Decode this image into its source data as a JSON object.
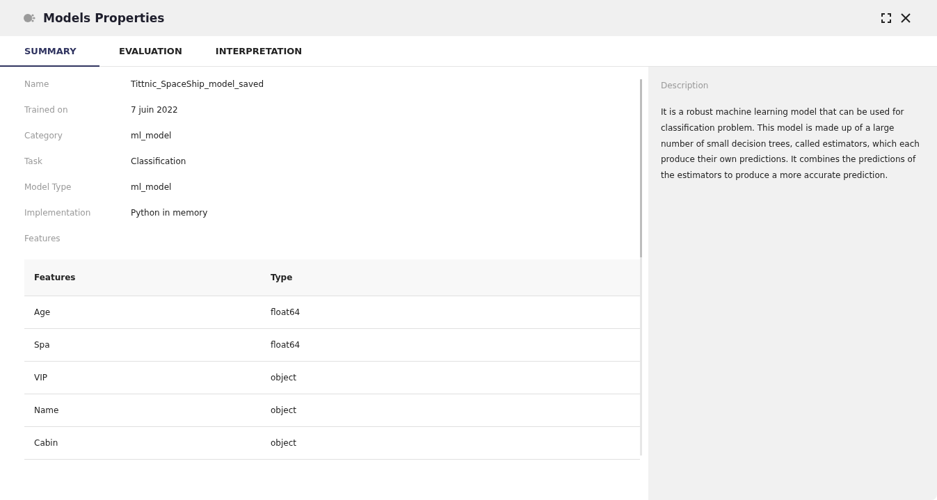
{
  "window": {
    "title": "Models Properties"
  },
  "tabs": [
    {
      "label": "SUMMARY",
      "selected": true
    },
    {
      "label": "EVALUATION",
      "selected": false
    },
    {
      "label": "INTERPRETATION",
      "selected": false
    }
  ],
  "properties": [
    {
      "label": "Name",
      "value": "Tittnic_SpaceShip_model_saved"
    },
    {
      "label": "Trained on",
      "value": "7 juin 2022"
    },
    {
      "label": "Category",
      "value": "ml_model"
    },
    {
      "label": "Task",
      "value": "Classification"
    },
    {
      "label": "Model Type",
      "value": "ml_model"
    },
    {
      "label": "Implementation",
      "value": "Python in memory"
    }
  ],
  "features_label": "Features",
  "table": {
    "columns": [
      "Features",
      "Type"
    ],
    "rows": [
      [
        "Age",
        "float64"
      ],
      [
        "Spa",
        "float64"
      ],
      [
        "VIP",
        "object"
      ],
      [
        "Name",
        "object"
      ],
      [
        "Cabin",
        "object"
      ]
    ]
  },
  "description": {
    "label": "Description",
    "text": "It is a robust machine learning model that can be used for classification problem. This model is made up of a large number of small decision trees, called estimators, which each produce their own predictions. It combines the predictions of the estimators to produce a more accurate prediction."
  }
}
